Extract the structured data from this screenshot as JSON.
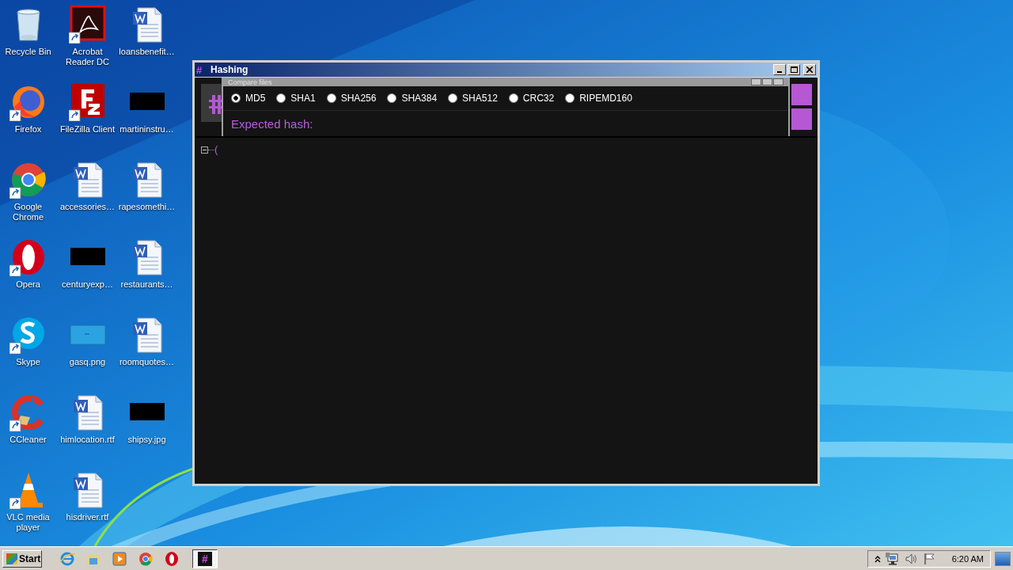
{
  "desktop": {
    "icons": [
      {
        "label": "Recycle Bin",
        "kind": "recycle",
        "shortcut": false
      },
      {
        "label": "Acrobat Reader DC",
        "kind": "acrobat",
        "shortcut": true
      },
      {
        "label": "loansbenefit…",
        "kind": "word",
        "shortcut": false
      },
      {
        "label": "Firefox",
        "kind": "firefox",
        "shortcut": true
      },
      {
        "label": "FileZilla Client",
        "kind": "filezilla",
        "shortcut": true
      },
      {
        "label": "martininstru…",
        "kind": "black",
        "shortcut": false
      },
      {
        "label": "Google Chrome",
        "kind": "chrome",
        "shortcut": true
      },
      {
        "label": "accessories…",
        "kind": "word",
        "shortcut": false
      },
      {
        "label": "rapesomethi…",
        "kind": "word",
        "shortcut": false
      },
      {
        "label": "Opera",
        "kind": "opera",
        "shortcut": true
      },
      {
        "label": "centuryexp…",
        "kind": "black",
        "shortcut": false
      },
      {
        "label": "restaurants…",
        "kind": "word",
        "shortcut": false
      },
      {
        "label": "Skype",
        "kind": "skype",
        "shortcut": true
      },
      {
        "label": "gasq.png",
        "kind": "blank",
        "shortcut": false
      },
      {
        "label": "roomquotes…",
        "kind": "word",
        "shortcut": false
      },
      {
        "label": "CCleaner",
        "kind": "ccleaner",
        "shortcut": true
      },
      {
        "label": "himlocation.rtf",
        "kind": "word",
        "shortcut": false
      },
      {
        "label": "shipsy.jpg",
        "kind": "black",
        "shortcut": false
      },
      {
        "label": "VLC media player",
        "kind": "vlc",
        "shortcut": true
      },
      {
        "label": "hisdriver.rtf",
        "kind": "word",
        "shortcut": false
      }
    ]
  },
  "window": {
    "icon": "#",
    "title": "Hashing",
    "panel": {
      "title": "Compare files",
      "algorithms": [
        {
          "label": "MD5",
          "selected": true
        },
        {
          "label": "SHA1",
          "selected": false
        },
        {
          "label": "SHA256",
          "selected": false
        },
        {
          "label": "SHA384",
          "selected": false
        },
        {
          "label": "SHA512",
          "selected": false
        },
        {
          "label": "CRC32",
          "selected": false
        },
        {
          "label": "RIPEMD160",
          "selected": false
        }
      ],
      "expected_hash_label": "Expected hash:"
    },
    "tree": [
      {
        "text": "(",
        "expanded": true
      }
    ]
  },
  "taskbar": {
    "start": "Start",
    "pinned": [
      {
        "kind": "ie"
      },
      {
        "kind": "explorer"
      },
      {
        "kind": "media"
      },
      {
        "kind": "chrome"
      },
      {
        "kind": "opera"
      }
    ],
    "task": {
      "icon": "#",
      "selected": true
    },
    "time": "6:20 AM"
  }
}
